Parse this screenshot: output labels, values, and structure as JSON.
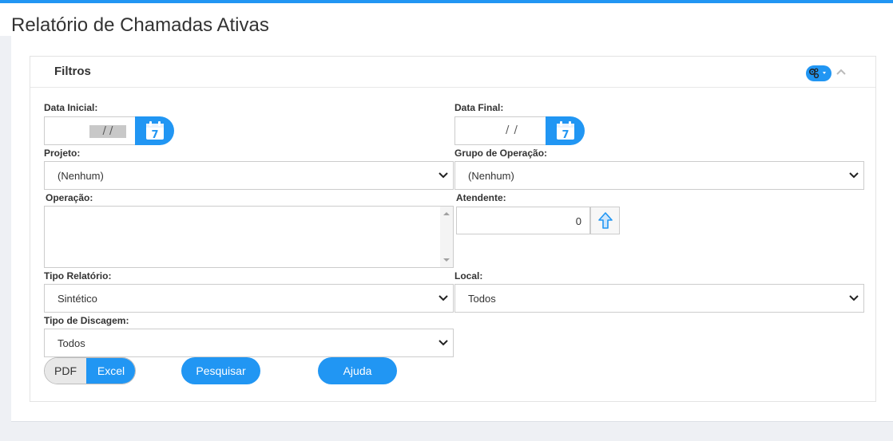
{
  "page": {
    "title": "Relatório de Chamadas Ativas"
  },
  "panel": {
    "title": "Filtros"
  },
  "colors": {
    "accent": "#2196f3"
  },
  "fields": {
    "data_inicial": {
      "label": "Data Inicial:",
      "value": " / /",
      "icon": "calendar-icon",
      "calendar_day": "7"
    },
    "data_final": {
      "label": "Data Final:",
      "value": " / /",
      "icon": "calendar-icon",
      "calendar_day": "7"
    },
    "projeto": {
      "label": "Projeto:",
      "value": "(Nenhum)"
    },
    "grupo_operacao": {
      "label": "Grupo de Operação:",
      "value": "(Nenhum)"
    },
    "operacao": {
      "label": "Operação:"
    },
    "atendente": {
      "label": "Atendente:",
      "value": "0",
      "icon": "arrow-up-icon"
    },
    "tipo_relatorio": {
      "label": "Tipo Relatório:",
      "value": "Sintético"
    },
    "local": {
      "label": "Local:",
      "value": "Todos"
    },
    "tipo_discagem": {
      "label": "Tipo de Discagem:",
      "value": "Todos"
    }
  },
  "actions": {
    "format_pdf": "PDF",
    "format_excel": "Excel",
    "format_selected": "Excel",
    "search": "Pesquisar",
    "help": "Ajuda"
  }
}
